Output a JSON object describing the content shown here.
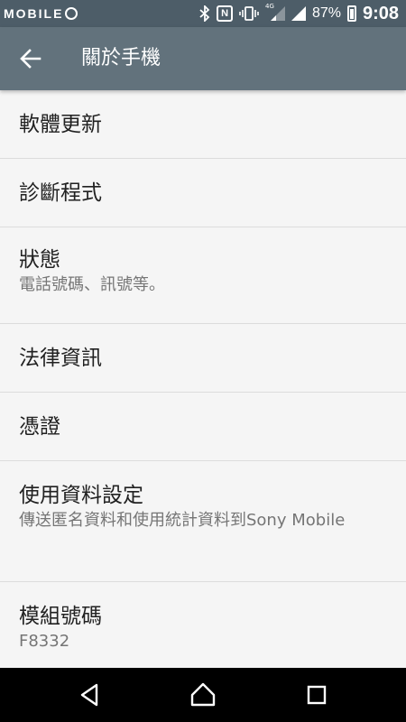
{
  "status_bar": {
    "brand": "MOBILE",
    "battery_percent": "87%",
    "time": "9:08",
    "network_type": "4G",
    "icons": [
      "bluetooth-icon",
      "nfc-icon",
      "vibrate-icon",
      "signal-icon",
      "battery-icon"
    ]
  },
  "app_bar": {
    "title": "關於手機",
    "back_icon": "arrow-back-icon"
  },
  "list": {
    "items": [
      {
        "title": "軟體更新"
      },
      {
        "title": "診斷程式"
      },
      {
        "title": "狀態",
        "subtitle": "電話號碼、訊號等。"
      },
      {
        "title": "法律資訊"
      },
      {
        "title": "憑證"
      },
      {
        "title": "使用資料設定",
        "subtitle": "傳送匿名資料和使用統計資料到Sony Mobile"
      },
      {
        "title": "模組號碼",
        "subtitle": "F8332"
      }
    ]
  },
  "nav_bar": {
    "buttons": [
      "back-triangle-icon",
      "home-icon",
      "recents-icon"
    ]
  },
  "colors": {
    "status_bar": "#4d5d68",
    "app_bar": "#62727c",
    "background": "#f5f5f5",
    "nav_bar": "#000000"
  }
}
